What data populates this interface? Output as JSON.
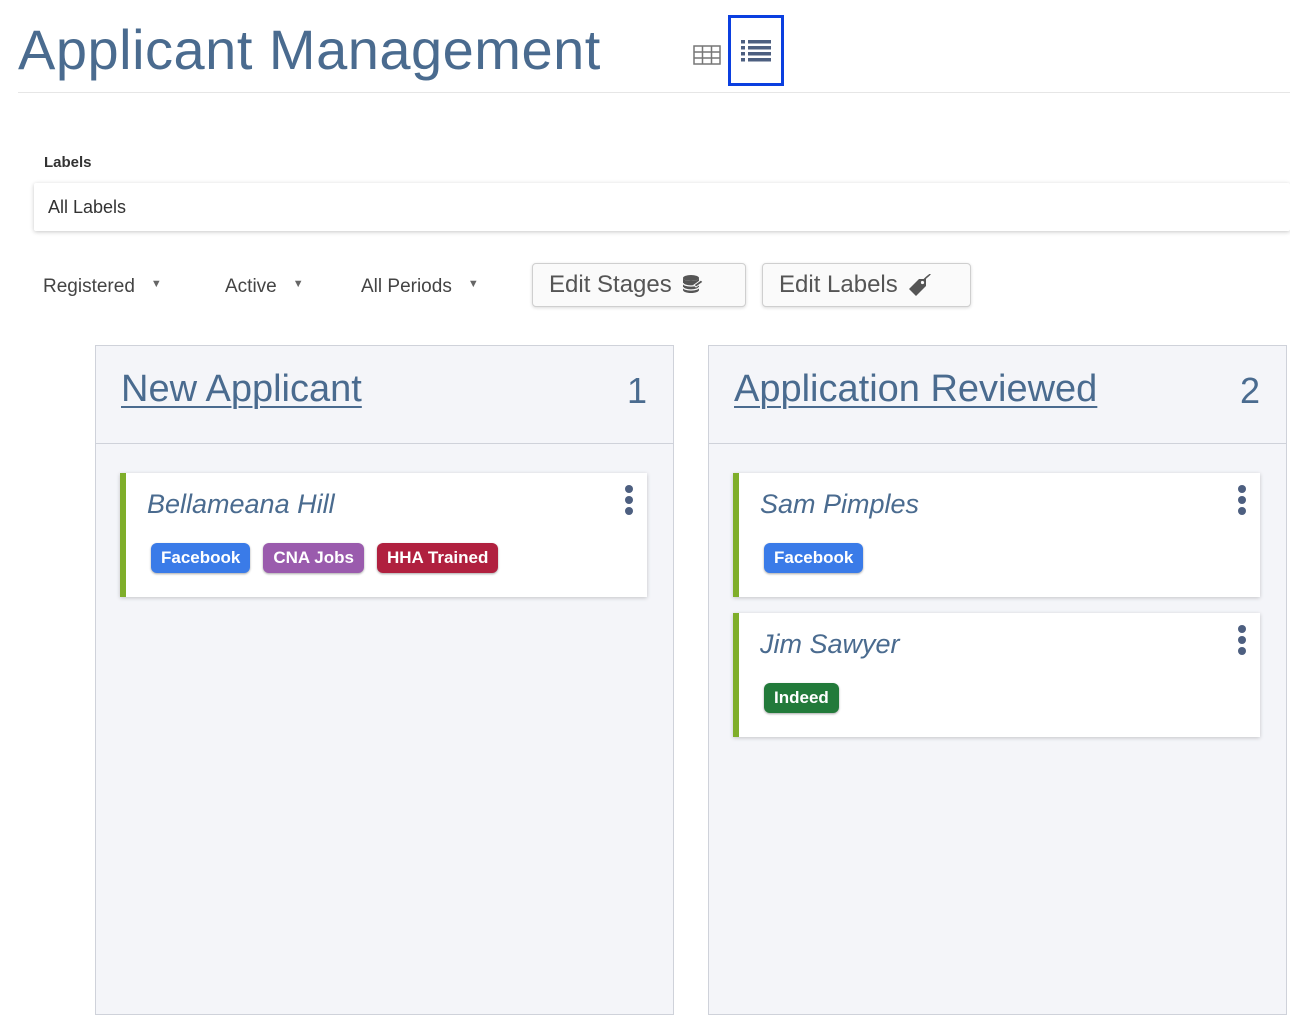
{
  "header": {
    "title": "Applicant Management",
    "views": {
      "table_icon": "table-grid-icon",
      "list_icon": "list-view-icon"
    }
  },
  "labels_filter": {
    "caption": "Labels",
    "value": "All Labels"
  },
  "filters": {
    "registered": "Registered",
    "status": "Active",
    "period": "All Periods"
  },
  "actions": {
    "edit_stages": "Edit Stages",
    "edit_stages_icon": "database-icon",
    "edit_labels": "Edit Labels",
    "edit_labels_icon": "tag-icon"
  },
  "colors": {
    "title": "#4a6b8f",
    "card_accent": "#7fae2a",
    "selected_view_outline": "#0b3fe0",
    "tag_facebook": "#3a7be8",
    "tag_cna_jobs": "#9a5bad",
    "tag_hha_trained": "#b0203f",
    "tag_indeed": "#227a3a"
  },
  "columns": [
    {
      "title": "New Applicant",
      "count": "1",
      "cards": [
        {
          "name": "Bellameana Hill",
          "tags": [
            "Facebook",
            "CNA Jobs",
            "HHA Trained"
          ]
        }
      ]
    },
    {
      "title": "Application Reviewed",
      "count": "2",
      "cards": [
        {
          "name": "Sam Pimples",
          "tags": [
            "Facebook"
          ]
        },
        {
          "name": "Jim Sawyer",
          "tags": [
            "Indeed"
          ]
        }
      ]
    }
  ]
}
